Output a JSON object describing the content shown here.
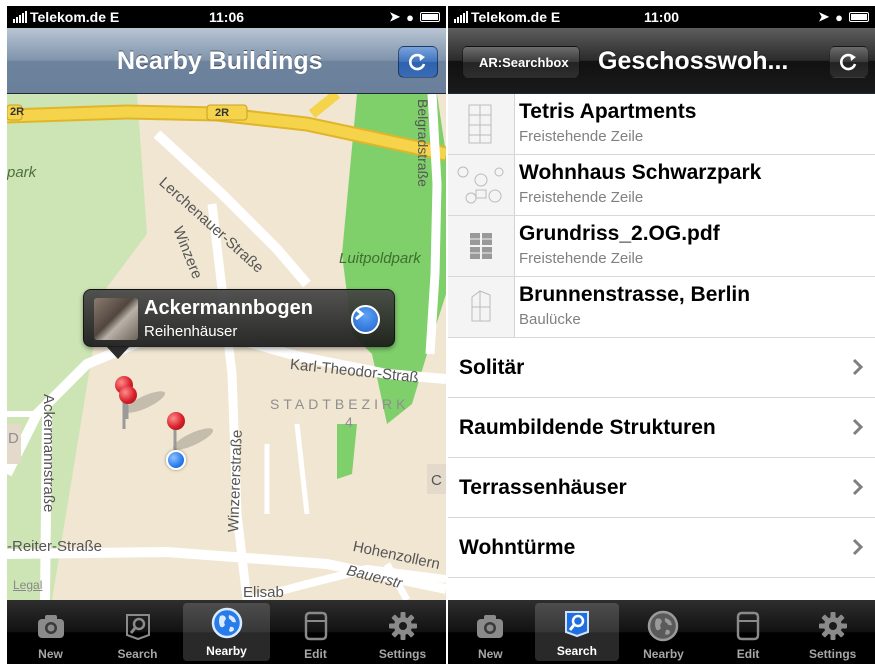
{
  "left": {
    "status": {
      "carrier": "Telekom.de",
      "network": "E",
      "time": "11:06"
    },
    "nav": {
      "title": "Nearby Buildings"
    },
    "map": {
      "labels": {
        "road_2r_a": "2R",
        "road_2r_b": "2R",
        "park_left": "park",
        "lerchenauer": "Lerchenauer-Straße",
        "winzerer_upper": "Winzere",
        "belgrad": "Belgradstraße",
        "luitpoldpark": "Luitpoldpark",
        "karl_theodor": "Karl-Theodor-Straß",
        "stadtbezirk": "STADTBEZIRK",
        "bezirk_number": "4",
        "ackermann": "Ackermannstraße",
        "winzerer_lower": "Winzererstraße",
        "reiter": "-Reiter-Straße",
        "hohenzollern": "Hohenzollern",
        "bauer": "Bauerstr",
        "elisab": "Elisab",
        "d_marker": "D",
        "c_marker": "C"
      },
      "legal": "Legal"
    },
    "callout": {
      "title": "Ackermannbogen",
      "subtitle": "Reihenhäuser"
    },
    "tabs": [
      {
        "label": "New",
        "icon": "camera-icon"
      },
      {
        "label": "Search",
        "icon": "search-icon"
      },
      {
        "label": "Nearby",
        "icon": "globe-icon"
      },
      {
        "label": "Edit",
        "icon": "document-icon"
      },
      {
        "label": "Settings",
        "icon": "gear-icon"
      }
    ],
    "active_tab": "Nearby"
  },
  "right": {
    "status": {
      "carrier": "Telekom.de",
      "network": "E",
      "time": "11:00"
    },
    "nav": {
      "back": "AR:Searchbox",
      "title": "Geschosswoh..."
    },
    "items": [
      {
        "title": "Tetris Apartments",
        "subtitle": "Freistehende Zeile"
      },
      {
        "title": "Wohnhaus Schwarzpark",
        "subtitle": "Freistehende Zeile"
      },
      {
        "title": "Grundriss_2.OG.pdf",
        "subtitle": "Freistehende Zeile"
      },
      {
        "title": "Brunnenstrasse, Berlin",
        "subtitle": "Baulücke"
      }
    ],
    "categories": [
      "Solitär",
      "Raumbildende Strukturen",
      "Terrassenhäuser",
      "Wohntürme"
    ],
    "tabs": [
      {
        "label": "New",
        "icon": "camera-icon"
      },
      {
        "label": "Search",
        "icon": "search-icon"
      },
      {
        "label": "Nearby",
        "icon": "globe-icon"
      },
      {
        "label": "Edit",
        "icon": "document-icon"
      },
      {
        "label": "Settings",
        "icon": "gear-icon"
      }
    ],
    "active_tab": "Search"
  },
  "colors": {
    "nav_blue": "#7f93ab",
    "button_blue": "#3f73bd",
    "park_green": "#7fcf6b",
    "highway_yellow": "#f5d34a",
    "pin_red": "#d8202a",
    "location_blue": "#2a7bea"
  }
}
